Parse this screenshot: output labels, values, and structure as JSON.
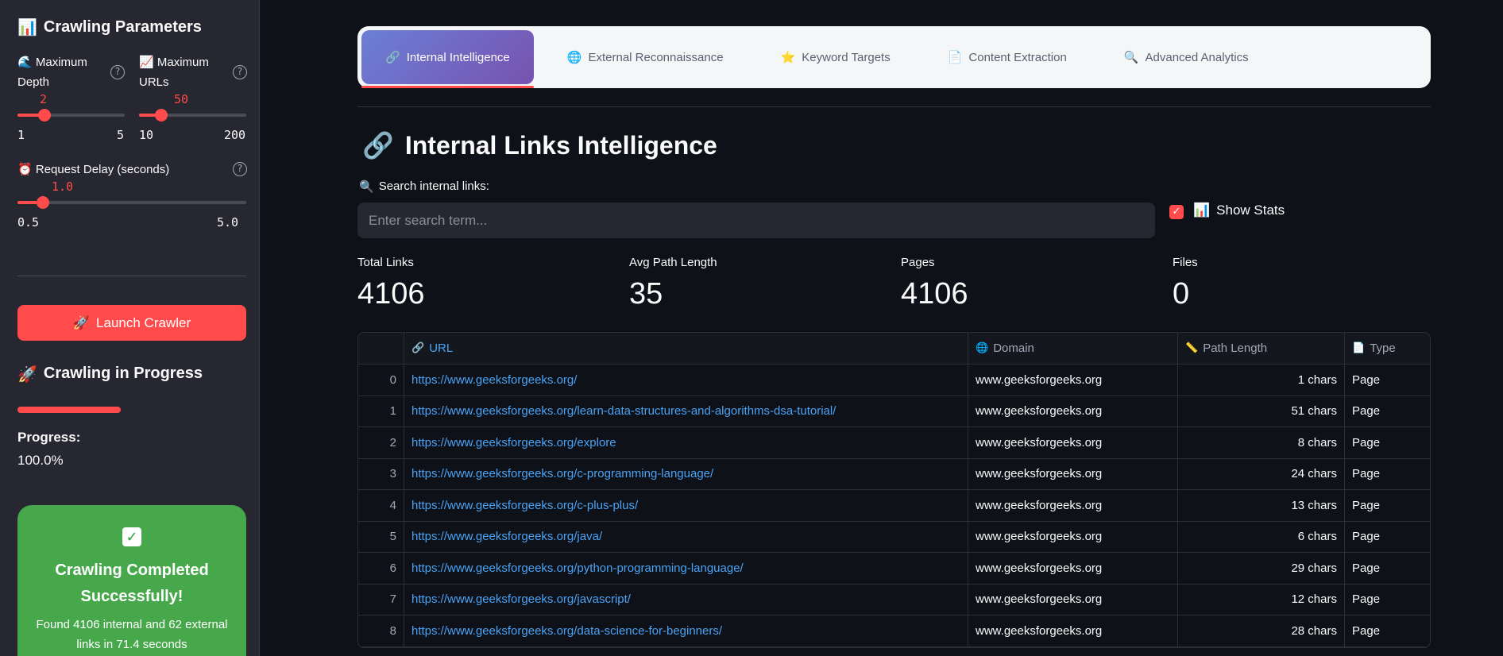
{
  "sidebar": {
    "title": "Crawling Parameters",
    "title_icon": "📊",
    "max_depth": {
      "icon": "🌊",
      "label_line1": "Maximum",
      "label_line2": "Depth",
      "value": "2",
      "min": "1",
      "max": "5",
      "fraction": 0.25
    },
    "max_urls": {
      "icon": "📈",
      "label_line1": "Maximum",
      "label_line2": "URLs",
      "value": "50",
      "min": "10",
      "max": "200",
      "fraction": 0.21
    },
    "delay": {
      "icon": "⏰",
      "label": "Request Delay (seconds)",
      "value": "1.0",
      "min": "0.5",
      "max": "5.0",
      "fraction": 0.11
    },
    "help_glyph": "?",
    "launch_button": "Launch Crawler",
    "launch_icon": "🚀",
    "progress_title": "Crawling in Progress",
    "progress_icon": "🚀",
    "progress_label": "Progress:",
    "progress_value": "100.0%",
    "success_icon": "✓",
    "success_title": "Crawling Completed Successfully!",
    "success_text": "Found 4106 internal and 62 external links in 71.4 seconds"
  },
  "tabs": [
    {
      "icon": "🔗",
      "label": "Internal Intelligence",
      "active": true
    },
    {
      "icon": "🌐",
      "label": "External Reconnaissance",
      "active": false
    },
    {
      "icon": "⭐",
      "label": "Keyword Targets",
      "active": false
    },
    {
      "icon": "📄",
      "label": "Content Extraction",
      "active": false
    },
    {
      "icon": "🔍",
      "label": "Advanced Analytics",
      "active": false
    }
  ],
  "main": {
    "title": "Internal Links Intelligence",
    "title_icon": "🔗",
    "search_label": "Search internal links:",
    "search_icon": "🔍",
    "search_placeholder": "Enter search term...",
    "show_stats_label": "Show Stats",
    "show_stats_icon": "📊",
    "show_stats_checked": true
  },
  "metrics": [
    {
      "label": "Total Links",
      "value": "4106"
    },
    {
      "label": "Avg Path Length",
      "value": "35"
    },
    {
      "label": "Pages",
      "value": "4106"
    },
    {
      "label": "Files",
      "value": "0"
    }
  ],
  "table": {
    "columns": [
      {
        "icon": "",
        "label": ""
      },
      {
        "icon": "🔗",
        "label": "URL"
      },
      {
        "icon": "🌐",
        "label": "Domain"
      },
      {
        "icon": "📏",
        "label": "Path Length"
      },
      {
        "icon": "📄",
        "label": "Type"
      }
    ],
    "rows": [
      [
        "0",
        "https://www.geeksforgeeks.org/",
        "www.geeksforgeeks.org",
        "1 chars",
        "Page"
      ],
      [
        "1",
        "https://www.geeksforgeeks.org/learn-data-structures-and-algorithms-dsa-tutorial/",
        "www.geeksforgeeks.org",
        "51 chars",
        "Page"
      ],
      [
        "2",
        "https://www.geeksforgeeks.org/explore",
        "www.geeksforgeeks.org",
        "8 chars",
        "Page"
      ],
      [
        "3",
        "https://www.geeksforgeeks.org/c-programming-language/",
        "www.geeksforgeeks.org",
        "24 chars",
        "Page"
      ],
      [
        "4",
        "https://www.geeksforgeeks.org/c-plus-plus/",
        "www.geeksforgeeks.org",
        "13 chars",
        "Page"
      ],
      [
        "5",
        "https://www.geeksforgeeks.org/java/",
        "www.geeksforgeeks.org",
        "6 chars",
        "Page"
      ],
      [
        "6",
        "https://www.geeksforgeeks.org/python-programming-language/",
        "www.geeksforgeeks.org",
        "29 chars",
        "Page"
      ],
      [
        "7",
        "https://www.geeksforgeeks.org/javascript/",
        "www.geeksforgeeks.org",
        "12 chars",
        "Page"
      ],
      [
        "8",
        "https://www.geeksforgeeks.org/data-science-for-beginners/",
        "www.geeksforgeeks.org",
        "28 chars",
        "Page"
      ]
    ]
  },
  "colors": {
    "accent": "#ff4b4b",
    "link": "#4aa3f5",
    "success": "#47a84b",
    "sidebar_bg": "#262730",
    "page_bg": "#0e1117"
  }
}
